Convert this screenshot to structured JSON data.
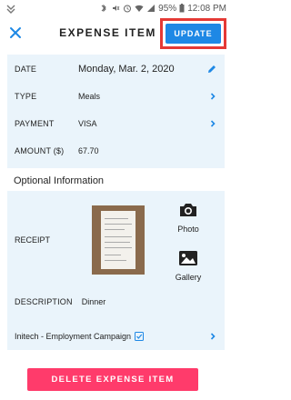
{
  "status_bar": {
    "battery": "95%",
    "time": "12:08 PM"
  },
  "header": {
    "title": "EXPENSE ITEM",
    "update_label": "UPDATE"
  },
  "fields": {
    "date": {
      "label": "DATE",
      "value": "Monday, Mar. 2, 2020"
    },
    "type": {
      "label": "TYPE",
      "value": "Meals"
    },
    "payment": {
      "label": "PAYMENT",
      "value": "VISA"
    },
    "amount": {
      "label": "AMOUNT ($)",
      "value": "67.70"
    }
  },
  "optional": {
    "section_title": "Optional Information",
    "receipt_label": "RECEIPT",
    "photo_label": "Photo",
    "gallery_label": "Gallery",
    "description_label": "DESCRIPTION",
    "description_value": "Dinner",
    "campaign_label": "Initech - Employment Campaign"
  },
  "actions": {
    "delete_label": "DELETE EXPENSE ITEM"
  },
  "colors": {
    "accent": "#1e88e5",
    "highlight_border": "#e53935",
    "delete": "#ff3b6b",
    "panel_bg": "#eaf4fb"
  },
  "icons": {
    "close": "close-icon",
    "edit": "pencil-icon",
    "chevron": "chevron-right-icon",
    "camera": "camera-icon",
    "gallery": "image-icon",
    "checkbox": "checkbox-checked-icon"
  }
}
